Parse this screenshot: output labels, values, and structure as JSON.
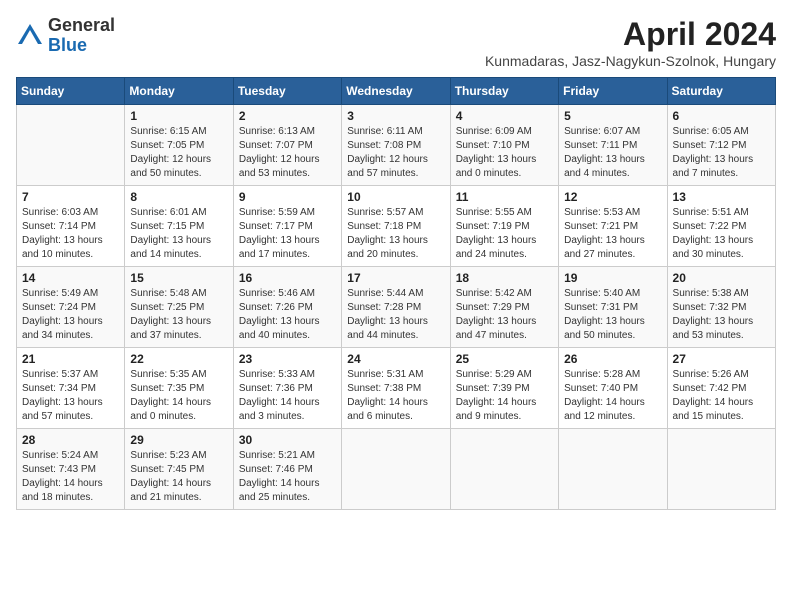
{
  "header": {
    "logo_general": "General",
    "logo_blue": "Blue",
    "month_title": "April 2024",
    "location": "Kunmadaras, Jasz-Nagykun-Szolnok, Hungary"
  },
  "calendar": {
    "days_of_week": [
      "Sunday",
      "Monday",
      "Tuesday",
      "Wednesday",
      "Thursday",
      "Friday",
      "Saturday"
    ],
    "weeks": [
      [
        {
          "day": "",
          "info": ""
        },
        {
          "day": "1",
          "info": "Sunrise: 6:15 AM\nSunset: 7:05 PM\nDaylight: 12 hours\nand 50 minutes."
        },
        {
          "day": "2",
          "info": "Sunrise: 6:13 AM\nSunset: 7:07 PM\nDaylight: 12 hours\nand 53 minutes."
        },
        {
          "day": "3",
          "info": "Sunrise: 6:11 AM\nSunset: 7:08 PM\nDaylight: 12 hours\nand 57 minutes."
        },
        {
          "day": "4",
          "info": "Sunrise: 6:09 AM\nSunset: 7:10 PM\nDaylight: 13 hours\nand 0 minutes."
        },
        {
          "day": "5",
          "info": "Sunrise: 6:07 AM\nSunset: 7:11 PM\nDaylight: 13 hours\nand 4 minutes."
        },
        {
          "day": "6",
          "info": "Sunrise: 6:05 AM\nSunset: 7:12 PM\nDaylight: 13 hours\nand 7 minutes."
        }
      ],
      [
        {
          "day": "7",
          "info": "Sunrise: 6:03 AM\nSunset: 7:14 PM\nDaylight: 13 hours\nand 10 minutes."
        },
        {
          "day": "8",
          "info": "Sunrise: 6:01 AM\nSunset: 7:15 PM\nDaylight: 13 hours\nand 14 minutes."
        },
        {
          "day": "9",
          "info": "Sunrise: 5:59 AM\nSunset: 7:17 PM\nDaylight: 13 hours\nand 17 minutes."
        },
        {
          "day": "10",
          "info": "Sunrise: 5:57 AM\nSunset: 7:18 PM\nDaylight: 13 hours\nand 20 minutes."
        },
        {
          "day": "11",
          "info": "Sunrise: 5:55 AM\nSunset: 7:19 PM\nDaylight: 13 hours\nand 24 minutes."
        },
        {
          "day": "12",
          "info": "Sunrise: 5:53 AM\nSunset: 7:21 PM\nDaylight: 13 hours\nand 27 minutes."
        },
        {
          "day": "13",
          "info": "Sunrise: 5:51 AM\nSunset: 7:22 PM\nDaylight: 13 hours\nand 30 minutes."
        }
      ],
      [
        {
          "day": "14",
          "info": "Sunrise: 5:49 AM\nSunset: 7:24 PM\nDaylight: 13 hours\nand 34 minutes."
        },
        {
          "day": "15",
          "info": "Sunrise: 5:48 AM\nSunset: 7:25 PM\nDaylight: 13 hours\nand 37 minutes."
        },
        {
          "day": "16",
          "info": "Sunrise: 5:46 AM\nSunset: 7:26 PM\nDaylight: 13 hours\nand 40 minutes."
        },
        {
          "day": "17",
          "info": "Sunrise: 5:44 AM\nSunset: 7:28 PM\nDaylight: 13 hours\nand 44 minutes."
        },
        {
          "day": "18",
          "info": "Sunrise: 5:42 AM\nSunset: 7:29 PM\nDaylight: 13 hours\nand 47 minutes."
        },
        {
          "day": "19",
          "info": "Sunrise: 5:40 AM\nSunset: 7:31 PM\nDaylight: 13 hours\nand 50 minutes."
        },
        {
          "day": "20",
          "info": "Sunrise: 5:38 AM\nSunset: 7:32 PM\nDaylight: 13 hours\nand 53 minutes."
        }
      ],
      [
        {
          "day": "21",
          "info": "Sunrise: 5:37 AM\nSunset: 7:34 PM\nDaylight: 13 hours\nand 57 minutes."
        },
        {
          "day": "22",
          "info": "Sunrise: 5:35 AM\nSunset: 7:35 PM\nDaylight: 14 hours\nand 0 minutes."
        },
        {
          "day": "23",
          "info": "Sunrise: 5:33 AM\nSunset: 7:36 PM\nDaylight: 14 hours\nand 3 minutes."
        },
        {
          "day": "24",
          "info": "Sunrise: 5:31 AM\nSunset: 7:38 PM\nDaylight: 14 hours\nand 6 minutes."
        },
        {
          "day": "25",
          "info": "Sunrise: 5:29 AM\nSunset: 7:39 PM\nDaylight: 14 hours\nand 9 minutes."
        },
        {
          "day": "26",
          "info": "Sunrise: 5:28 AM\nSunset: 7:40 PM\nDaylight: 14 hours\nand 12 minutes."
        },
        {
          "day": "27",
          "info": "Sunrise: 5:26 AM\nSunset: 7:42 PM\nDaylight: 14 hours\nand 15 minutes."
        }
      ],
      [
        {
          "day": "28",
          "info": "Sunrise: 5:24 AM\nSunset: 7:43 PM\nDaylight: 14 hours\nand 18 minutes."
        },
        {
          "day": "29",
          "info": "Sunrise: 5:23 AM\nSunset: 7:45 PM\nDaylight: 14 hours\nand 21 minutes."
        },
        {
          "day": "30",
          "info": "Sunrise: 5:21 AM\nSunset: 7:46 PM\nDaylight: 14 hours\nand 25 minutes."
        },
        {
          "day": "",
          "info": ""
        },
        {
          "day": "",
          "info": ""
        },
        {
          "day": "",
          "info": ""
        },
        {
          "day": "",
          "info": ""
        }
      ]
    ]
  }
}
